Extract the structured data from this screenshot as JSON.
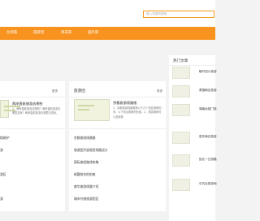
{
  "search": {
    "placeholder": "输入关键词搜索..."
  },
  "nav": {
    "items": [
      "台湾旅",
      "旅游团",
      "周末游",
      "国外游"
    ]
  },
  "left_panel": {
    "more_label": "更多",
    "feature": {
      "title": "两岸直航旅游去哪些",
      "text": "1、两岸直航旅游去哪些？两岸直航旅游去哪里游玩？两岸直航旅游去哪里去游玩。"
    },
    "list": [
      "相继护",
      "游",
      "",
      "游区",
      "",
      "",
      "游"
    ]
  },
  "mid_panel": {
    "title": "旅游团",
    "more_label": "更多",
    "feature": {
      "title": "京都旅游线路推",
      "text": "1、京都旅游线路推荐以下几个景区推荐如何，以下景点推荐的的线。2、旅游推荐可以选择旅"
    },
    "list": [
      "京都旅游线路推",
      "旅游团开放观赏线路设计",
      "国际旅游路线攻略",
      "新疆排名的由来",
      "赫华旅游线路介绍",
      "城市外旅旅游团区"
    ]
  },
  "right_panel": {
    "title": "热门文章",
    "items": [
      "毓开四川旅游",
      "泰国两边旅游",
      "湖南远回门旅",
      "居东两边旅游",
      "结元一日游路",
      "中式台旅游地"
    ]
  }
}
